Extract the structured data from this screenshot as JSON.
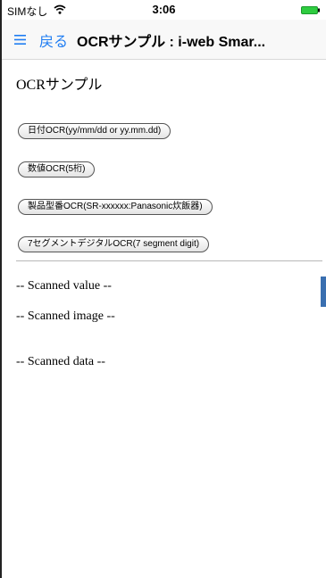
{
  "status_bar": {
    "carrier": "SIMなし",
    "time": "3:06",
    "battery_color": "#2ecc40"
  },
  "nav": {
    "back_label": "戻る",
    "title": "OCRサンプル : i-web Smar...",
    "accent_color": "#1e7cf2"
  },
  "page": {
    "heading": "OCRサンプル",
    "buttons": [
      {
        "label": "日付OCR(yy/mm/dd or yy.mm.dd)"
      },
      {
        "label": "数値OCR(5桁)"
      },
      {
        "label": "製品型番OCR(SR-xxxxxx:Panasonic炊飯器)"
      },
      {
        "label": "7セグメントデジタルOCR(7 segment digit)"
      }
    ],
    "scanned_value_label": "-- Scanned value --",
    "scanned_image_label": "-- Scanned image --",
    "scanned_data_label": "-- Scanned data --"
  }
}
